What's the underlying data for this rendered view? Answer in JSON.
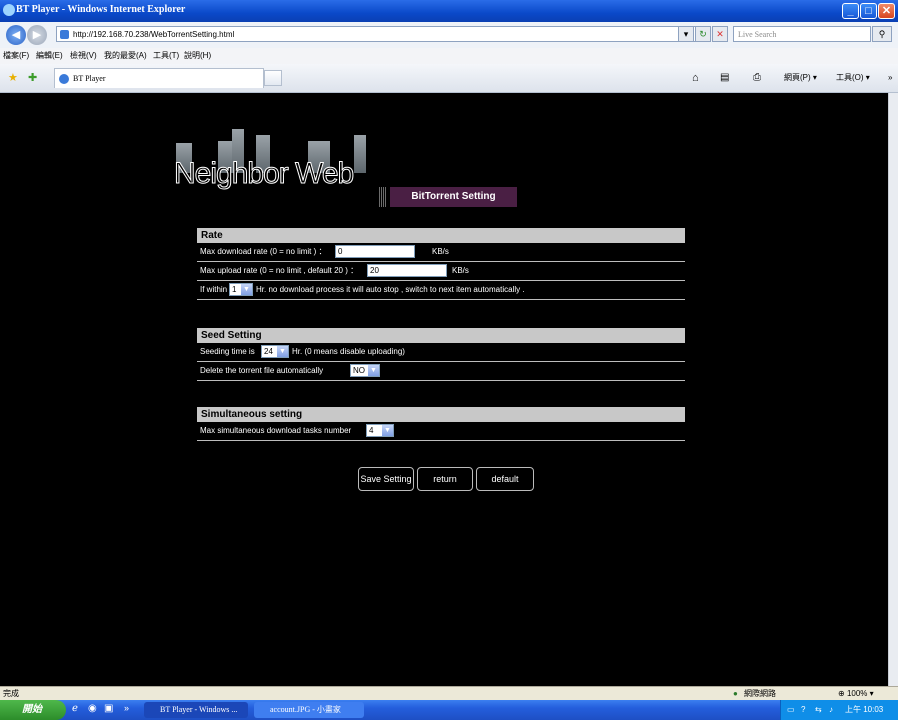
{
  "window": {
    "title": "BT Player - Windows Internet Explorer",
    "minimize": "_",
    "maximize": "□",
    "close": "✕"
  },
  "address_bar": {
    "url": "http://192.168.70.238/WebTorrentSetting.html",
    "search_placeholder": "Live Search"
  },
  "menu": [
    "檔案(F)",
    "編輯(E)",
    "檢視(V)",
    "我的最愛(A)",
    "工具(T)",
    "說明(H)"
  ],
  "tab": {
    "label": "BT Player"
  },
  "command_bar": {
    "page_label": "網頁(P)",
    "tools_label": "工具(O)",
    "more": "»"
  },
  "page": {
    "logo_text": "Neighbor Web",
    "heading": "BitTorrent Setting",
    "rate": {
      "title": "Rate",
      "max_download_label": "Max download rate (0 = no limit ) ：",
      "max_download_value": "0",
      "max_download_unit": "KB/s",
      "max_upload_label": "Max upload rate (0 = no limit , default 20 ) ：",
      "max_upload_value": "20",
      "max_upload_unit": "KB/s",
      "within_prefix": "If within",
      "within_value": "1",
      "within_suffix": "Hr. no download process it will auto stop , switch to next item automatically ."
    },
    "seed": {
      "title": "Seed Setting",
      "seeding_prefix": "Seeding time is",
      "seeding_value": "24",
      "seeding_suffix": "Hr. (0 means disable uploading)",
      "delete_label": "Delete the torrent file automatically",
      "delete_value": "NO"
    },
    "simultaneous": {
      "title": "Simultaneous setting",
      "max_tasks_label": "Max simultaneous download tasks number",
      "max_tasks_value": "4"
    },
    "buttons": {
      "save": "Save Setting",
      "return": "return",
      "default": "default"
    }
  },
  "status_bar": {
    "status": "完成",
    "zone": "網際網路",
    "zoom": "100%"
  },
  "taskbar": {
    "start": "開始",
    "tasks": [
      "BT Player - Windows ...",
      "account.JPG - 小畫家"
    ],
    "clock": "上午 10:03"
  }
}
